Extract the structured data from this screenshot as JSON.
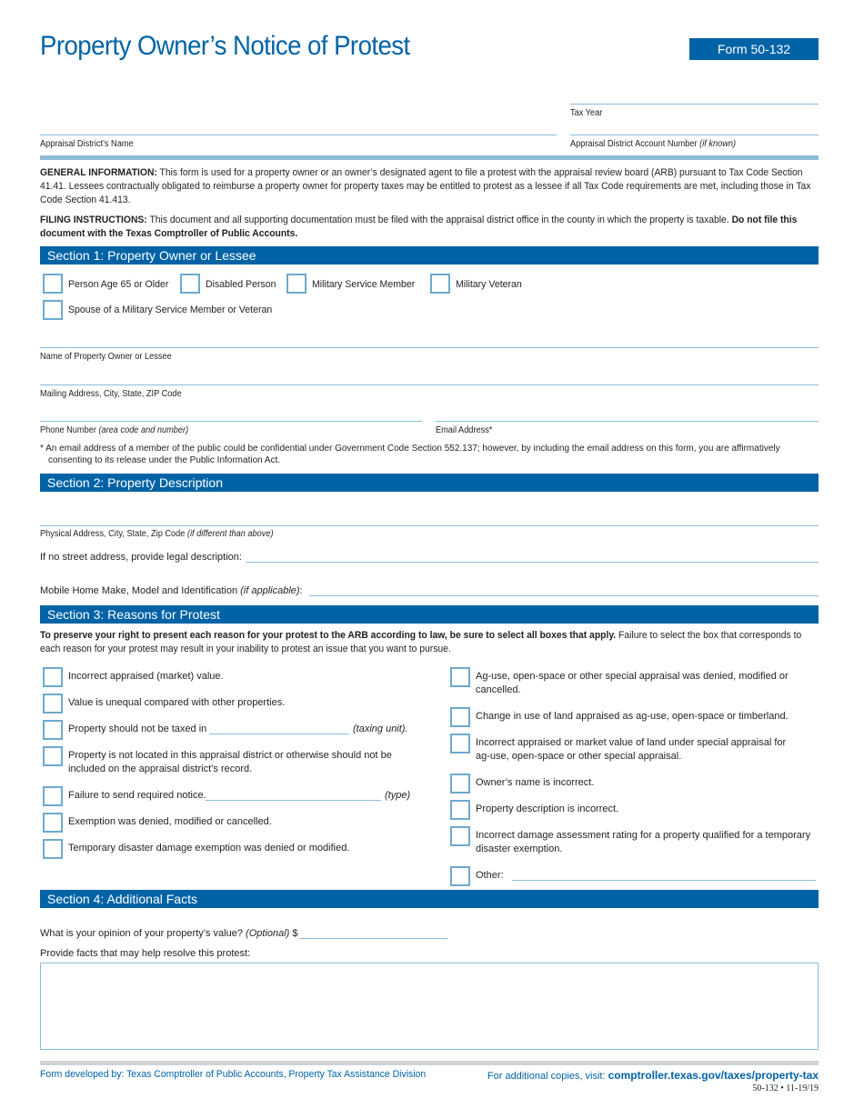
{
  "header": {
    "title": "Property Owner’s Notice of Protest",
    "form_number": "Form 50-132"
  },
  "top_fields": {
    "tax_year_label": "Tax Year",
    "district_name_label": "Appraisal District’s Name",
    "account_number_label": "Appraisal District Account Number",
    "account_number_note": "(if known)"
  },
  "general_info": {
    "heading": "GENERAL INFORMATION:",
    "text": "This form is used for a property owner or an owner’s designated agent to file a protest with the appraisal review board (ARB) pursuant to Tax Code Section 41.41. Lessees contractually obligated to reimburse a property owner for property taxes may be entitled to protest as a lessee if all Tax Code requirements are met, including those in Tax Code Section 41.413."
  },
  "filing_instructions": {
    "heading": "FILING INSTRUCTIONS:",
    "text": "This document and all supporting documentation must be filed with the appraisal district office in the county in which the property is taxable.",
    "bold_text": "Do not file this document with the Texas Comptroller of Public Accounts."
  },
  "section1": {
    "title": "Section 1: Property Owner or Lessee",
    "checkboxes": [
      {
        "label": "Person Age 65 or Older",
        "checked": false
      },
      {
        "label": "Disabled Person",
        "checked": false
      },
      {
        "label": "Military Service Member",
        "checked": false
      },
      {
        "label": "Military Veteran",
        "checked": false
      },
      {
        "label": "Spouse of a Military Service Member or Veteran",
        "checked": false
      }
    ],
    "name_label": "Name of Property Owner or Lessee",
    "mailing_label": "Mailing Address, City, State, ZIP Code",
    "phone_label": "Phone Number",
    "phone_note": "(area code and number)",
    "email_label": "Email Address*",
    "footnote": "* An email address of a member of the public could be confidential under Government Code Section 552.137; however, by including the email address on this form, you are affirmatively consenting to its release under the Public Information Act."
  },
  "section2": {
    "title": "Section 2: Property Description",
    "physical_address_label": "Physical Address, City, State, Zip Code",
    "physical_address_note": "(if different than above)",
    "legal_description_label": "If no street address, provide legal description:",
    "mobile_home_label": "Mobile Home Make, Model and Identification",
    "mobile_home_note": "(if applicable)",
    "mobile_home_colon": ":"
  },
  "section3": {
    "title": "Section 3: Reasons for Protest",
    "intro_bold": "To preserve your right to present each reason for your protest to the ARB according to law, be sure to select all boxes that apply.",
    "intro_text": "Failure to select the box that corresponds to each reason for your protest may result in your inability to protest an issue that you want to pursue.",
    "left_reasons": [
      {
        "label": "Incorrect appraised (market) value.",
        "checked": false
      },
      {
        "label": "Value is unequal compared with other properties.",
        "checked": false
      },
      {
        "label": "Property should not be taxed in",
        "suffix": "(taxing unit).",
        "checked": false
      },
      {
        "label": "Property is not located in this appraisal district or otherwise should not be included on the appraisal district’s record.",
        "checked": false
      },
      {
        "label": "Failure to send required notice.",
        "suffix": "(type)",
        "checked": false
      },
      {
        "label": "Exemption was denied, modified or cancelled.",
        "checked": false
      },
      {
        "label": "Temporary disaster damage exemption was denied or modified.",
        "checked": false
      }
    ],
    "right_reasons": [
      {
        "label": "Ag-use, open-space or other special appraisal was denied, modified or cancelled.",
        "checked": false
      },
      {
        "label": "Change in use of land appraised as ag-use, open-space or timberland.",
        "checked": false
      },
      {
        "label": "Incorrect appraised or market value of land under special appraisal for ag-use, open-space or other special appraisal.",
        "checked": false
      },
      {
        "label": "Owner’s name is incorrect.",
        "checked": false
      },
      {
        "label": "Property description is incorrect.",
        "checked": false
      },
      {
        "label": "Incorrect damage assessment rating for a property qualified for a temporary disaster exemption.",
        "checked": false
      },
      {
        "label": "Other:",
        "checked": false
      }
    ]
  },
  "section4": {
    "title": "Section 4: Additional Facts",
    "opinion_label": "What is your opinion of your property’s value?",
    "opinion_note": "(Optional)",
    "opinion_currency": "$",
    "facts_label": "Provide facts that may help resolve this protest:",
    "facts_value": ""
  },
  "footer": {
    "developed_by": "Form developed by: Texas Comptroller of Public Accounts, Property Tax Assistance Division",
    "copies_text": "For additional copies, visit:",
    "copies_link": "comptroller.texas.gov/taxes/property-tax",
    "form_code": "50-132 • 11-19/19"
  },
  "colors": {
    "brand_blue": "#0063a6",
    "line_blue": "#8cbcd8",
    "checkbox_border": "#6da9cf",
    "footer_bar": "#d0d3d6"
  }
}
